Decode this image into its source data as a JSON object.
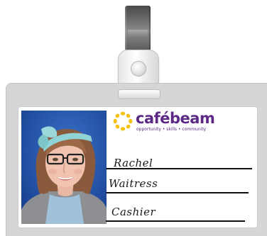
{
  "badge": {
    "brand": {
      "name": "cafébeam",
      "tagline": "opportunity • skills • community",
      "text_color": "#5c2a86",
      "ring_colors": [
        "#f4c20d",
        "#f9dc3c",
        "#e8b400"
      ]
    },
    "fields": {
      "name": "Rachel",
      "role": "Waitress",
      "duty": "Cashier"
    },
    "colors": {
      "holder": "#d6d6d6",
      "clip": "#6a6a6a",
      "photo_background": "#1f4fa6"
    },
    "photo": {
      "alt": "Staff photo"
    }
  }
}
